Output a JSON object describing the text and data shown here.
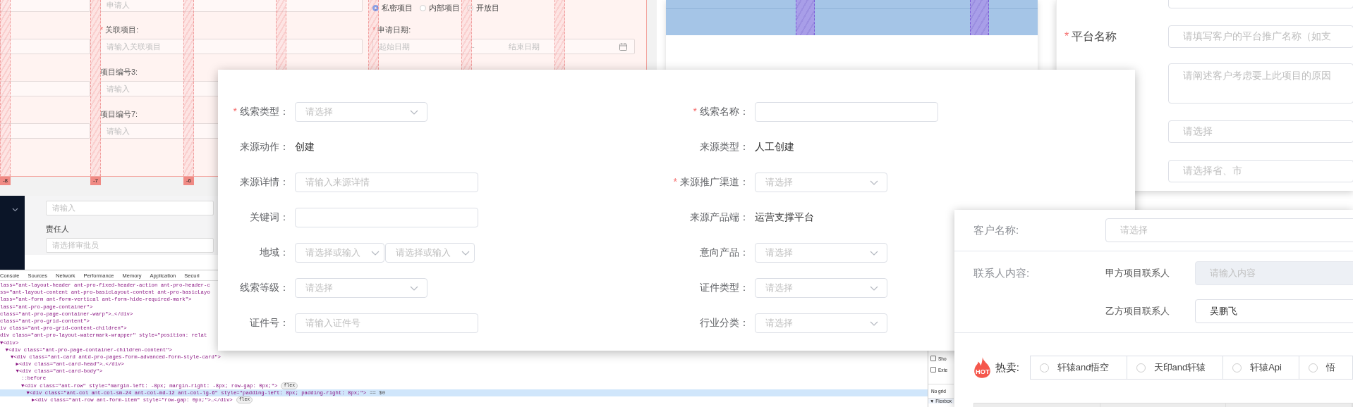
{
  "project_form_window": {
    "applicant_placeholder": "申请人",
    "visibility_options": [
      {
        "label": "私密项目",
        "selected": true
      },
      {
        "label": "内部项目",
        "selected": false
      },
      {
        "label": "开放目",
        "selected": false
      }
    ],
    "fields": [
      {
        "kind": "input",
        "label": "关联项目:",
        "required_mark": "*",
        "placeholder": "请输入关联项目"
      },
      {
        "kind": "range",
        "label": "申请日期:",
        "required_mark": "*",
        "start_placeholder": "起始日期",
        "separator": "-",
        "end_placeholder": "结束日期"
      },
      {
        "kind": "input",
        "label": "项目编号3:",
        "placeholder": "请输入"
      },
      {
        "kind": "input",
        "label": "项目编号7:",
        "placeholder": "请输入"
      }
    ],
    "column_markers": [
      "-8",
      "-7",
      "-6"
    ]
  },
  "task_page": {
    "task_placeholder": "请输入",
    "owner_label": "责任人",
    "owner_placeholder": "请选择审批员"
  },
  "devtools": {
    "tabs": [
      "Console",
      "Sources",
      "Network",
      "Performance",
      "Memory",
      "Application",
      "Securi"
    ],
    "lines": [
      {
        "text": "lass=\"ant-layout-header ant-pro-fixed-header-action ant-pro-header-c",
        "selected": false
      },
      {
        "text": "ss=\"ant-layout-content ant-pro-basicLayout-content ant-pro-basicLayo",
        "selected": false
      },
      {
        "text": "lass=\"ant-form ant-form-vertical ant-form-hide-required-mark\">",
        "selected": false
      },
      {
        "text": "lass=\"ant-pro-page-container\">",
        "selected": false
      },
      {
        "text": " class=\"ant-pro-page-container-warp\">…</div>",
        "selected": false
      },
      {
        "text": " class=\"ant-pro-grid-content\">",
        "selected": false
      },
      {
        "text": "iv class=\"ant-pro-grid-content-children\">",
        "selected": false
      },
      {
        "text": "div class=\"ant-pro-layout-watermark-wrapper\" style=\"position: relat",
        "selected": false
      },
      {
        "text": "▼<div>",
        "selected": false,
        "children": [
          {
            "text": "▼<div class=\"ant-pro-page-container-children-content\">",
            "selected": false,
            "children": [
              {
                "text": "▼<div class=\"ant-card antd-pro-pages-form-advanced-form-style-card\">",
                "selected": false,
                "children": [
                  {
                    "text": "▶<div class=\"ant-card-head\">…</div>",
                    "selected": false
                  },
                  {
                    "text": "▼<div class=\"ant-card-body\">",
                    "selected": false,
                    "children": [
                      {
                        "text": "::before",
                        "selected": false
                      },
                      {
                        "text": "▼<div class=\"ant-row\" style=\"margin-left: -8px; margin-right: -8px; row-gap: 0px;\">",
                        "selected": false,
                        "badge": "flex",
                        "children": [
                          {
                            "text": "▼<div class=\"ant-col ant-col-sm-24 ant-col-md-12 ant-col-lg-6\" style=\"padding-left: 8px; padding-right: 8px;\">",
                            "selected": true,
                            "suffix": "== $0",
                            "children": [
                              {
                                "text": "▶<div class=\"ant-row ant-form-item\" style=\"row-gap: 0px;\">…</div>",
                                "selected": false,
                                "badge": "flex"
                              }
                            ]
                          }
                        ]
                      }
                    ]
                  }
                ]
              }
            ]
          }
        ]
      }
    ],
    "side_options": [
      {
        "label": "Sho",
        "checked": false
      },
      {
        "label": "Exte",
        "checked": false
      }
    ],
    "grid_note": "No grid",
    "flexbox_section": "▼ Flexbox"
  },
  "platform_form_window": {
    "platform_label": "平台名称",
    "platform_required_mark": "*",
    "platform_placeholder": "请填写客户的平台推广名称（如支",
    "reason_placeholder": "请阐述客户考虑要上此项目的原因",
    "select_placeholder": "请选择",
    "region_placeholder": "请选择省、市"
  },
  "lead_form": {
    "left": [
      {
        "kind": "select",
        "label": "线索类型：",
        "required_mark": "*",
        "placeholder": "请选择"
      },
      {
        "kind": "text",
        "label": "来源动作：",
        "value": "创建"
      },
      {
        "kind": "input",
        "label": "来源详情：",
        "placeholder": "请输入来源详情"
      },
      {
        "kind": "input",
        "label": "关键词："
      },
      {
        "kind": "double_select",
        "label": "地域：",
        "placeholders": [
          "请选择或输入",
          "请选择或输入"
        ]
      },
      {
        "kind": "select",
        "label": "线索等级：",
        "placeholder": "请选择"
      },
      {
        "kind": "input",
        "label": "证件号：",
        "placeholder": "请输入证件号"
      }
    ],
    "right": [
      {
        "kind": "input",
        "label": "线索名称：",
        "required_mark": "*"
      },
      {
        "kind": "text",
        "label": "来源类型：",
        "value": "人工创建"
      },
      {
        "kind": "select",
        "label": "来源推广渠道：",
        "required_mark": "*",
        "placeholder": "请选择"
      },
      {
        "kind": "text",
        "label": "来源产品端：",
        "value": "运营支撑平台"
      },
      {
        "kind": "select",
        "label": "意向产品：",
        "placeholder": "请选择"
      },
      {
        "kind": "select",
        "label": "证件类型：",
        "placeholder": "请选择"
      },
      {
        "kind": "select",
        "label": "行业分类：",
        "placeholder": "请选择"
      }
    ]
  },
  "customer_window": {
    "customer_label": "客户名称:",
    "customer_placeholder": "请选择",
    "contacts_label": "联系人内容:",
    "contacts": [
      {
        "label": "甲方项目联系人",
        "disabled": true,
        "placeholder": "请输入内容"
      },
      {
        "label": "乙方项目联系人",
        "disabled": false,
        "value": "吴鹏飞"
      }
    ],
    "hot_badge": "HOT",
    "hot_label": "热卖:",
    "hot_options": [
      {
        "label": "轩辕and悟空",
        "selected": false
      },
      {
        "label": "天印and轩辕",
        "selected": false
      },
      {
        "label": "轩辕Api",
        "selected": false
      },
      {
        "label": "悟",
        "selected": false
      }
    ]
  }
}
